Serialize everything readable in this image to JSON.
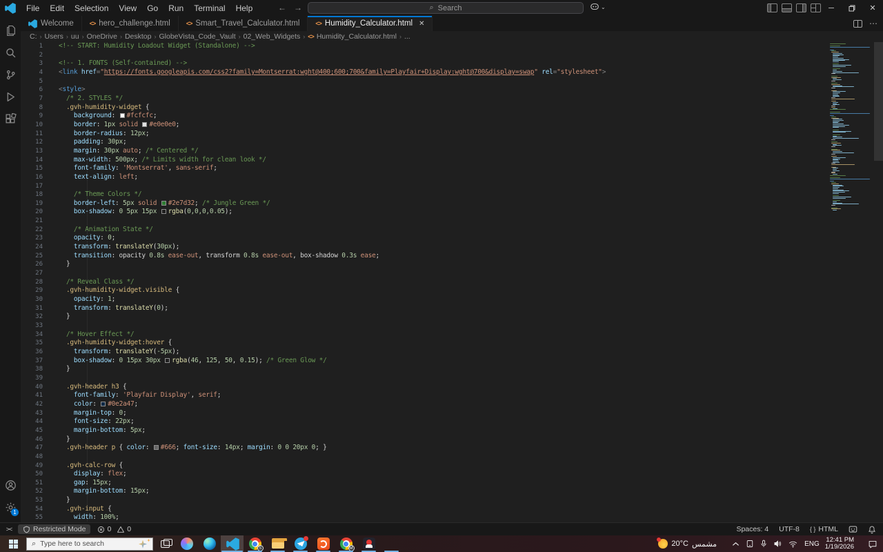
{
  "titlebar": {
    "menus": [
      "File",
      "Edit",
      "Selection",
      "View",
      "Go",
      "Run",
      "Terminal",
      "Help"
    ],
    "search_placeholder": "Search",
    "back_arrow": "←",
    "forward_arrow": "→"
  },
  "tabs": [
    {
      "label": "Welcome",
      "icon": "vscode",
      "active": false
    },
    {
      "label": "hero_challenge.html",
      "icon": "html",
      "active": false
    },
    {
      "label": "Smart_Travel_Calculator.html",
      "icon": "html",
      "active": false
    },
    {
      "label": "Humidity_Calculator.html",
      "icon": "html",
      "active": true
    }
  ],
  "breadcrumb": [
    "C:",
    "Users",
    "uu",
    "OneDrive",
    "Desktop",
    "GlobeVista_Code_Vault",
    "02_Web_Widgets",
    "Humidity_Calculator.html",
    "..."
  ],
  "activitybar": {
    "top": [
      "explorer",
      "search",
      "source-control",
      "run-debug",
      "extensions"
    ],
    "bottom": [
      "accounts",
      "settings"
    ],
    "settings_badge": "1"
  },
  "editor": {
    "token_colors": {
      "c": "#6a9955",
      "t": "#569cd6",
      "a": "#9cdcfe",
      "s": "#ce9178",
      "u": "#ce9178",
      "p": "#808080",
      "sel": "#d7ba7d",
      "pr": "#9cdcfe",
      "n": "#b5cea8",
      "v": "#ce9178",
      "w": "#d4d4d4",
      "fn": "#dcdcaa"
    },
    "lines": [
      [
        [
          "c",
          "<!-- START: Humidity Loadout Widget (Standalone) -->"
        ]
      ],
      [],
      [
        [
          "c",
          "<!-- 1. FONTS (Self-contained) -->"
        ]
      ],
      [
        [
          "p",
          "<"
        ],
        [
          "t",
          "link"
        ],
        [
          "w",
          " "
        ],
        [
          "a",
          "href"
        ],
        [
          "p",
          "="
        ],
        [
          "s",
          "\""
        ],
        [
          "u",
          "https://fonts.googleapis.com/css2?family=Montserrat:wght@400;600;700&family=Playfair+Display:wght@700&display=swap"
        ],
        [
          "s",
          "\""
        ],
        [
          "w",
          " "
        ],
        [
          "a",
          "rel"
        ],
        [
          "p",
          "="
        ],
        [
          "s",
          "\"stylesheet\""
        ],
        [
          "p",
          ">"
        ]
      ],
      [],
      [
        [
          "p",
          "<"
        ],
        [
          "t",
          "style"
        ],
        [
          "p",
          ">"
        ]
      ],
      [
        [
          "c",
          "  /* 2. STYLES */"
        ]
      ],
      [
        [
          "sel",
          "  .gvh-humidity-widget"
        ],
        [
          "w",
          " {"
        ]
      ],
      [
        [
          "pr",
          "    background"
        ],
        [
          "w",
          ": "
        ],
        [
          "sw",
          "#fcfcfc"
        ],
        [
          "v",
          "#fcfcfc"
        ],
        [
          "w",
          ";"
        ]
      ],
      [
        [
          "pr",
          "    border"
        ],
        [
          "w",
          ": "
        ],
        [
          "n",
          "1px"
        ],
        [
          "v",
          " solid "
        ],
        [
          "sw",
          "#e0e0e0"
        ],
        [
          "v",
          "#e0e0e0"
        ],
        [
          "w",
          ";"
        ]
      ],
      [
        [
          "pr",
          "    border-radius"
        ],
        [
          "w",
          ": "
        ],
        [
          "n",
          "12px"
        ],
        [
          "w",
          ";"
        ]
      ],
      [
        [
          "pr",
          "    padding"
        ],
        [
          "w",
          ": "
        ],
        [
          "n",
          "30px"
        ],
        [
          "w",
          ";"
        ]
      ],
      [
        [
          "pr",
          "    margin"
        ],
        [
          "w",
          ": "
        ],
        [
          "n",
          "30px"
        ],
        [
          "v",
          " auto"
        ],
        [
          "w",
          "; "
        ],
        [
          "c",
          "/* Centered */"
        ]
      ],
      [
        [
          "pr",
          "    max-width"
        ],
        [
          "w",
          ": "
        ],
        [
          "n",
          "500px"
        ],
        [
          "w",
          "; "
        ],
        [
          "c",
          "/* Limits width for clean look */"
        ]
      ],
      [
        [
          "pr",
          "    font-family"
        ],
        [
          "w",
          ": "
        ],
        [
          "s",
          "'Montserrat'"
        ],
        [
          "w",
          ", "
        ],
        [
          "v",
          "sans-serif"
        ],
        [
          "w",
          ";"
        ]
      ],
      [
        [
          "pr",
          "    text-align"
        ],
        [
          "w",
          ": "
        ],
        [
          "v",
          "left"
        ],
        [
          "w",
          ";"
        ]
      ],
      [],
      [
        [
          "c",
          "    /* Theme Colors */"
        ]
      ],
      [
        [
          "pr",
          "    border-left"
        ],
        [
          "w",
          ": "
        ],
        [
          "n",
          "5px"
        ],
        [
          "v",
          " solid "
        ],
        [
          "sw",
          "#2e7d32"
        ],
        [
          "v",
          "#2e7d32"
        ],
        [
          "w",
          "; "
        ],
        [
          "c",
          "/* Jungle Green */"
        ]
      ],
      [
        [
          "pr",
          "    box-shadow"
        ],
        [
          "w",
          ": "
        ],
        [
          "n",
          "0 5px 15px "
        ],
        [
          "swo",
          ""
        ],
        [
          "fn",
          "rgba"
        ],
        [
          "w",
          "("
        ],
        [
          "n",
          "0,0,0,0.05"
        ],
        [
          "w",
          ");"
        ]
      ],
      [],
      [
        [
          "c",
          "    /* Animation State */"
        ]
      ],
      [
        [
          "pr",
          "    opacity"
        ],
        [
          "w",
          ": "
        ],
        [
          "n",
          "0"
        ],
        [
          "w",
          ";"
        ]
      ],
      [
        [
          "pr",
          "    transform"
        ],
        [
          "w",
          ": "
        ],
        [
          "fn",
          "translateY"
        ],
        [
          "w",
          "("
        ],
        [
          "n",
          "30px"
        ],
        [
          "w",
          ");"
        ]
      ],
      [
        [
          "pr",
          "    transition"
        ],
        [
          "w",
          ": opacity "
        ],
        [
          "n",
          "0.8s"
        ],
        [
          "v",
          " ease-out"
        ],
        [
          "w",
          ", transform "
        ],
        [
          "n",
          "0.8s"
        ],
        [
          "v",
          " ease-out"
        ],
        [
          "w",
          ", box-shadow "
        ],
        [
          "n",
          "0.3s"
        ],
        [
          "v",
          " ease"
        ],
        [
          "w",
          ";"
        ]
      ],
      [
        [
          "w",
          "  }"
        ]
      ],
      [],
      [
        [
          "c",
          "  /* Reveal Class */"
        ]
      ],
      [
        [
          "sel",
          "  .gvh-humidity-widget.visible"
        ],
        [
          "w",
          " {"
        ]
      ],
      [
        [
          "pr",
          "    opacity"
        ],
        [
          "w",
          ": "
        ],
        [
          "n",
          "1"
        ],
        [
          "w",
          ";"
        ]
      ],
      [
        [
          "pr",
          "    transform"
        ],
        [
          "w",
          ": "
        ],
        [
          "fn",
          "translateY"
        ],
        [
          "w",
          "("
        ],
        [
          "n",
          "0"
        ],
        [
          "w",
          ");"
        ]
      ],
      [
        [
          "w",
          "  }"
        ]
      ],
      [],
      [
        [
          "c",
          "  /* Hover Effect */"
        ]
      ],
      [
        [
          "sel",
          "  .gvh-humidity-widget:hover"
        ],
        [
          "w",
          " {"
        ]
      ],
      [
        [
          "pr",
          "    transform"
        ],
        [
          "w",
          ": "
        ],
        [
          "fn",
          "translateY"
        ],
        [
          "w",
          "("
        ],
        [
          "n",
          "-5px"
        ],
        [
          "w",
          ");"
        ]
      ],
      [
        [
          "pr",
          "    box-shadow"
        ],
        [
          "w",
          ": "
        ],
        [
          "n",
          "0 15px 30px "
        ],
        [
          "swo",
          ""
        ],
        [
          "fn",
          "rgba"
        ],
        [
          "w",
          "("
        ],
        [
          "n",
          "46"
        ],
        [
          "w",
          ", "
        ],
        [
          "n",
          "125"
        ],
        [
          "w",
          ", "
        ],
        [
          "n",
          "50"
        ],
        [
          "w",
          ", "
        ],
        [
          "n",
          "0.15"
        ],
        [
          "w",
          "); "
        ],
        [
          "c",
          "/* Green Glow */"
        ]
      ],
      [
        [
          "w",
          "  }"
        ]
      ],
      [],
      [
        [
          "sel",
          "  .gvh-header h3"
        ],
        [
          "w",
          " {"
        ]
      ],
      [
        [
          "pr",
          "    font-family"
        ],
        [
          "w",
          ": "
        ],
        [
          "s",
          "'Playfair Display'"
        ],
        [
          "w",
          ", "
        ],
        [
          "v",
          "serif"
        ],
        [
          "w",
          ";"
        ]
      ],
      [
        [
          "pr",
          "    color"
        ],
        [
          "w",
          ": "
        ],
        [
          "sw",
          "#0e2a47"
        ],
        [
          "v",
          "#0e2a47"
        ],
        [
          "w",
          ";"
        ]
      ],
      [
        [
          "pr",
          "    margin-top"
        ],
        [
          "w",
          ": "
        ],
        [
          "n",
          "0"
        ],
        [
          "w",
          ";"
        ]
      ],
      [
        [
          "pr",
          "    font-size"
        ],
        [
          "w",
          ": "
        ],
        [
          "n",
          "22px"
        ],
        [
          "w",
          ";"
        ]
      ],
      [
        [
          "pr",
          "    margin-bottom"
        ],
        [
          "w",
          ": "
        ],
        [
          "n",
          "5px"
        ],
        [
          "w",
          ";"
        ]
      ],
      [
        [
          "w",
          "  }"
        ]
      ],
      [
        [
          "sel",
          "  .gvh-header p"
        ],
        [
          "w",
          " { "
        ],
        [
          "pr",
          "color"
        ],
        [
          "w",
          ": "
        ],
        [
          "sw",
          "#666666"
        ],
        [
          "v",
          "#666"
        ],
        [
          "w",
          "; "
        ],
        [
          "pr",
          "font-size"
        ],
        [
          "w",
          ": "
        ],
        [
          "n",
          "14px"
        ],
        [
          "w",
          "; "
        ],
        [
          "pr",
          "margin"
        ],
        [
          "w",
          ": "
        ],
        [
          "n",
          "0 0 20px 0"
        ],
        [
          "w",
          "; }"
        ]
      ],
      [],
      [
        [
          "sel",
          "  .gvh-calc-row"
        ],
        [
          "w",
          " {"
        ]
      ],
      [
        [
          "pr",
          "    display"
        ],
        [
          "w",
          ": "
        ],
        [
          "v",
          "flex"
        ],
        [
          "w",
          ";"
        ]
      ],
      [
        [
          "pr",
          "    gap"
        ],
        [
          "w",
          ": "
        ],
        [
          "n",
          "15px"
        ],
        [
          "w",
          ";"
        ]
      ],
      [
        [
          "pr",
          "    margin-bottom"
        ],
        [
          "w",
          ": "
        ],
        [
          "n",
          "15px"
        ],
        [
          "w",
          ";"
        ]
      ],
      [
        [
          "w",
          "  }"
        ]
      ],
      [
        [
          "sel",
          "  .gvh-input"
        ],
        [
          "w",
          " {"
        ]
      ],
      [
        [
          "pr",
          "    width"
        ],
        [
          "w",
          ": "
        ],
        [
          "n",
          "100%"
        ],
        [
          "w",
          ";"
        ]
      ]
    ]
  },
  "statusbar": {
    "remote_glyph": "><",
    "restricted_label": "Restricted Mode",
    "errors": "0",
    "warnings": "0",
    "spaces": "Spaces: 4",
    "encoding": "UTF-8",
    "lang_glyph": "{ }",
    "language": "HTML"
  },
  "taskbar": {
    "search_placeholder": "Type here to search",
    "apps": [
      {
        "name": "copilot",
        "running": false,
        "active": false,
        "badge": ""
      },
      {
        "name": "edge",
        "running": false,
        "active": false,
        "badge": ""
      },
      {
        "name": "vscode",
        "running": true,
        "active": true,
        "badge": ""
      },
      {
        "name": "chrome-profile-s",
        "running": true,
        "active": false,
        "badge": "S"
      },
      {
        "name": "file-explorer",
        "running": true,
        "active": false,
        "badge": ""
      },
      {
        "name": "telegram",
        "running": true,
        "active": false,
        "badge": "dot"
      },
      {
        "name": "orange-utility",
        "running": true,
        "active": false,
        "badge": ""
      },
      {
        "name": "chrome-profile-m",
        "running": true,
        "active": false,
        "badge": "M"
      },
      {
        "name": "media-app-dark",
        "running": true,
        "active": false,
        "badge": ""
      },
      {
        "name": "vlc",
        "running": true,
        "active": false,
        "badge": ""
      }
    ],
    "weather": {
      "temp": "20°C",
      "condition": "مشمس"
    },
    "tray": {
      "language": "ENG",
      "time": "12:41 PM",
      "date": "1/19/2026"
    }
  },
  "accent": "#0078d4"
}
